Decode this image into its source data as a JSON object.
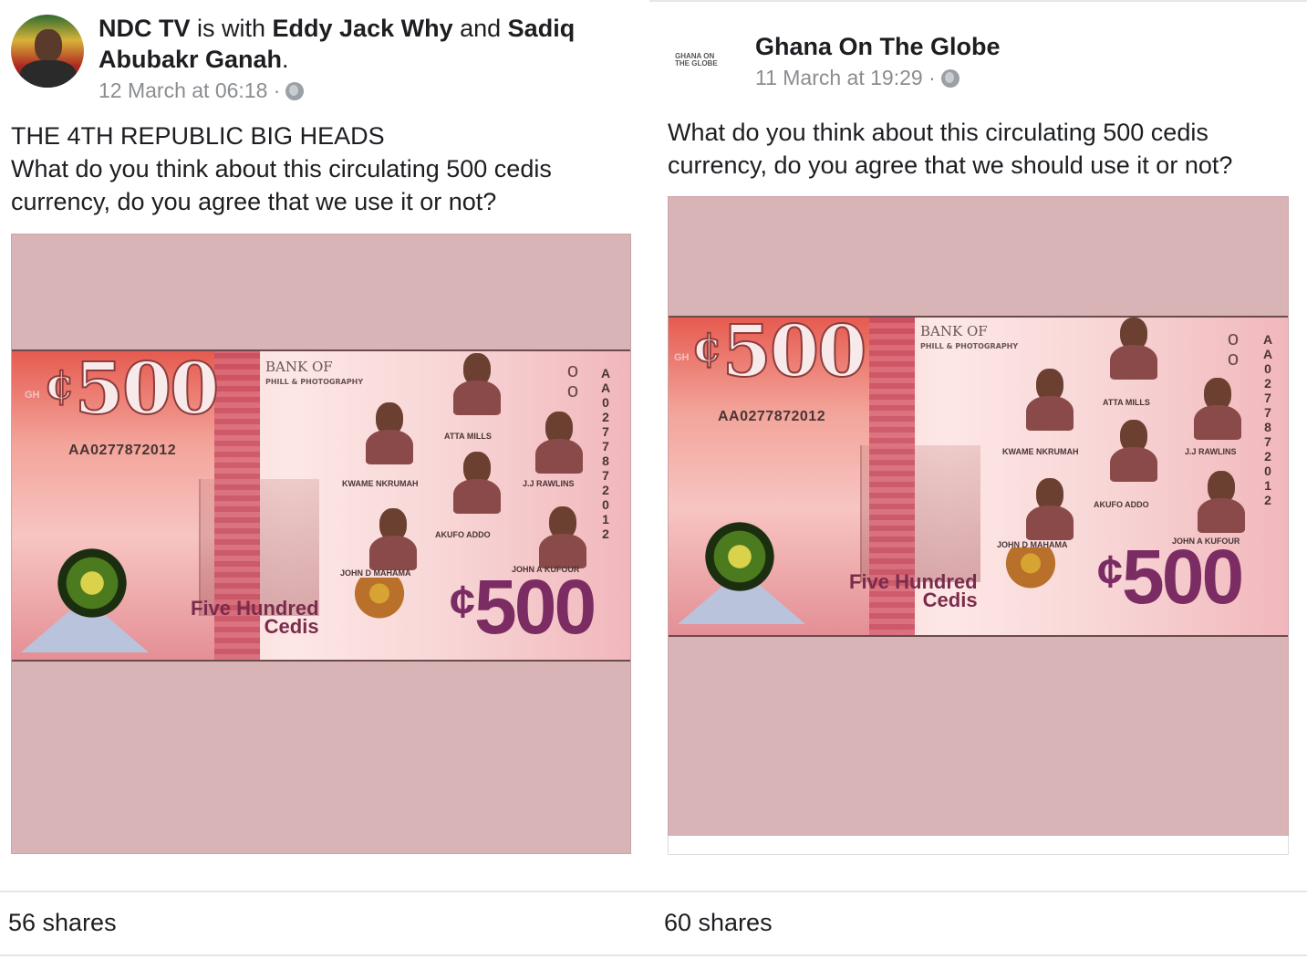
{
  "left_post": {
    "author": "NDC TV",
    "with_text": " is with ",
    "tagged_1": "Eddy Jack Why",
    "and_text": " and ",
    "tagged_2_line1": "Sadiq",
    "tagged_2_line2": "Abubakr Ganah",
    "period": ".",
    "timestamp": "12 March at 06:18 ·",
    "text_lines": [
      "THE 4TH REPUBLIC BIG HEADS",
      "What do you think about this circulating 500 cedis",
      "currency, do you agree that we use it or not?"
    ],
    "shares": "56 shares",
    "privacy_icon": "globe-icon"
  },
  "right_post": {
    "author": "Ghana On The Globe",
    "timestamp": "11 March at 19:29 ·",
    "text_lines": [
      "What do you think about this circulating 500 cedis",
      "currency, do you agree that we should use it or not?"
    ],
    "shares": "60 shares",
    "privacy_icon": "globe-icon",
    "avatar_text": "GHANA ON THE GLOBE"
  },
  "banknote": {
    "denomination": "500",
    "currency_symbol": "¢",
    "gh_prefix": "GH",
    "serial": "AA0277872012",
    "vertical_serial": "AA027787 2012",
    "bank_title": "BANK OF",
    "bank_subtitle": "PHILL & PHOTOGRAPHY",
    "words_line1": "Five Hundred",
    "words_line2": "Cedis",
    "rings": "o o",
    "portraits": {
      "atta_mills": "ATTA MILLS",
      "nkrumah": "KWAME NKRUMAH",
      "rawlings": "J.J RAWLINS",
      "akufo_addo": "AKUFO ADDO",
      "mahama": "JOHN D MAHAMA",
      "kufuor": "JOHN A KUFOUR"
    }
  }
}
